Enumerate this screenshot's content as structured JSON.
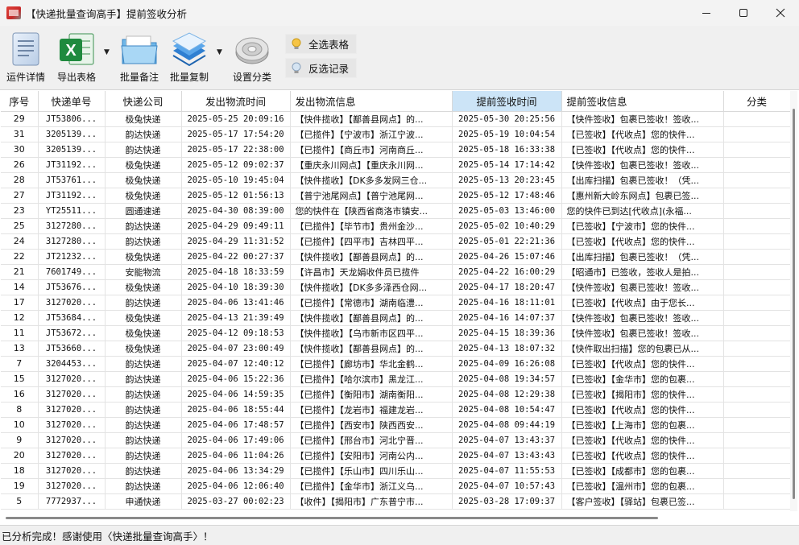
{
  "window": {
    "title": "【快递批量查询高手】提前签收分析",
    "controls": {
      "minimize": "—",
      "maximize": "☐",
      "close": "✕"
    }
  },
  "toolbar": {
    "buttons": [
      {
        "label": "运件详情",
        "icon": "document-icon"
      },
      {
        "label": "导出表格",
        "icon": "excel-icon",
        "dropdown": true
      },
      {
        "label": "批量备注",
        "icon": "folder-icon"
      },
      {
        "label": "批量复制",
        "icon": "copy-stack-icon",
        "dropdown": true
      },
      {
        "label": "设置分类",
        "icon": "gear-icon"
      }
    ],
    "select_all": "全选表格",
    "invert_select": "反选记录"
  },
  "table": {
    "columns": [
      "序号",
      "快递单号",
      "快递公司",
      "发出物流时间",
      "发出物流信息",
      "提前签收时间",
      "提前签收信息",
      "分类"
    ],
    "rows": [
      [
        "29",
        "JT53806...",
        "极兔快递",
        "2025-05-25 20:09:16",
        "【快件揽收】【鄯善县网点】的...",
        "2025-05-30 20:25:56",
        "【快件签收】包裹已签收！签收...",
        ""
      ],
      [
        "31",
        "3205139...",
        "韵达快递",
        "2025-05-17 17:54:20",
        "【已揽件】【宁波市】浙江宁波...",
        "2025-05-19 10:04:54",
        "【已签收】【代收点】您的快件...",
        ""
      ],
      [
        "30",
        "3205139...",
        "韵达快递",
        "2025-05-17 22:38:00",
        "【已揽件】【商丘市】河南商丘...",
        "2025-05-18 16:33:38",
        "【已签收】【代收点】您的快件...",
        ""
      ],
      [
        "26",
        "JT31192...",
        "极兔快递",
        "2025-05-12 09:02:37",
        "【重庆永川网点】【重庆永川网...",
        "2025-05-14 17:14:42",
        "【快件签收】包裹已签收！签收...",
        ""
      ],
      [
        "28",
        "JT53761...",
        "极兔快递",
        "2025-05-10 19:45:04",
        "【快件揽收】【DK多多发网三仓...",
        "2025-05-13 20:23:45",
        "【出库扫描】包裹已签收！（凭...",
        ""
      ],
      [
        "27",
        "JT31192...",
        "极兔快递",
        "2025-05-12 01:56:13",
        "【普宁池尾网点】【普宁池尾网...",
        "2025-05-12 17:48:46",
        "【惠州新大岭东网点】包裹已签...",
        ""
      ],
      [
        "23",
        "YT25511...",
        "圆通速递",
        "2025-04-30 08:39:00",
        "您的快件在【陕西省商洛市镇安...",
        "2025-05-03 13:46:00",
        "您的快件已到达[代收点](永福...",
        ""
      ],
      [
        "25",
        "3127280...",
        "韵达快递",
        "2025-04-29 09:49:11",
        "【已揽件】【毕节市】贵州金沙...",
        "2025-05-02 10:40:29",
        "【已签收】【宁波市】您的快件...",
        ""
      ],
      [
        "24",
        "3127280...",
        "韵达快递",
        "2025-04-29 11:31:52",
        "【已揽件】【四平市】吉林四平...",
        "2025-05-01 22:21:36",
        "【已签收】【代收点】您的快件...",
        ""
      ],
      [
        "22",
        "JT21232...",
        "极兔快递",
        "2025-04-22 00:27:37",
        "【快件揽收】【鄯善县网点】的...",
        "2025-04-26 15:07:46",
        "【出库扫描】包裹已签收！（凭...",
        ""
      ],
      [
        "21",
        "7601749...",
        "安能物流",
        "2025-04-18 18:33:59",
        "【许昌市】天龙娟收件员已揽件",
        "2025-04-22 16:00:29",
        "【昭通市】已签收，签收人是拍...",
        ""
      ],
      [
        "14",
        "JT53676...",
        "极兔快递",
        "2025-04-10 18:39:30",
        "【快件揽收】【DK多多泽西仓网...",
        "2025-04-17 18:20:47",
        "【快件签收】包裹已签收！签收...",
        ""
      ],
      [
        "17",
        "3127020...",
        "韵达快递",
        "2025-04-06 13:41:46",
        "【已揽件】【常德市】湖南临澧...",
        "2025-04-16 18:11:01",
        "【已签收】【代收点】由于您长...",
        ""
      ],
      [
        "12",
        "JT53684...",
        "极兔快递",
        "2025-04-13 21:39:49",
        "【快件揽收】【鄯善县网点】的...",
        "2025-04-16 14:07:37",
        "【快件签收】包裹已签收！签收...",
        ""
      ],
      [
        "11",
        "JT53672...",
        "极兔快递",
        "2025-04-12 09:18:53",
        "【快件揽收】【乌市新市区四平...",
        "2025-04-15 18:39:36",
        "【快件签收】包裹已签收！签收...",
        ""
      ],
      [
        "13",
        "JT53660...",
        "极兔快递",
        "2025-04-07 23:00:49",
        "【快件揽收】【鄯善县网点】的...",
        "2025-04-13 18:07:32",
        "【快件取出扫描】您的包裹已从...",
        ""
      ],
      [
        "7",
        "3204453...",
        "韵达快递",
        "2025-04-07 12:40:12",
        "【已揽件】【廊坊市】华北金鹤...",
        "2025-04-09 16:26:08",
        "【已签收】【代收点】您的快件...",
        ""
      ],
      [
        "15",
        "3127020...",
        "韵达快递",
        "2025-04-06 15:22:36",
        "【已揽件】【哈尔滨市】黑龙江...",
        "2025-04-08 19:34:57",
        "【已签收】【金华市】您的包裹...",
        ""
      ],
      [
        "16",
        "3127020...",
        "韵达快递",
        "2025-04-06 14:59:35",
        "【已揽件】【衡阳市】湖南衡阳...",
        "2025-04-08 12:29:38",
        "【已签收】【揭阳市】您的快件...",
        ""
      ],
      [
        "8",
        "3127020...",
        "韵达快递",
        "2025-04-06 18:55:44",
        "【已揽件】【龙岩市】福建龙岩...",
        "2025-04-08 10:54:47",
        "【已签收】【代收点】您的快件...",
        ""
      ],
      [
        "10",
        "3127020...",
        "韵达快递",
        "2025-04-06 17:48:57",
        "【已揽件】【西安市】陕西西安...",
        "2025-04-08 09:44:19",
        "【已签收】【上海市】您的包裹...",
        ""
      ],
      [
        "9",
        "3127020...",
        "韵达快递",
        "2025-04-06 17:49:06",
        "【已揽件】【邢台市】河北宁晋...",
        "2025-04-07 13:43:37",
        "【已签收】【代收点】您的快件...",
        ""
      ],
      [
        "20",
        "3127020...",
        "韵达快递",
        "2025-04-06 11:04:26",
        "【已揽件】【安阳市】河南公内...",
        "2025-04-07 13:43:43",
        "【已签收】【代收点】您的快件...",
        ""
      ],
      [
        "18",
        "3127020...",
        "韵达快递",
        "2025-04-06 13:34:29",
        "【已揽件】【乐山市】四川乐山...",
        "2025-04-07 11:55:53",
        "【已签收】【成都市】您的包裹...",
        ""
      ],
      [
        "19",
        "3127020...",
        "韵达快递",
        "2025-04-06 12:06:40",
        "【已揽件】【金华市】浙江义乌...",
        "2025-04-07 10:57:43",
        "【已签收】【温州市】您的包裹...",
        ""
      ],
      [
        "5",
        "7772937...",
        "申通快递",
        "2025-03-27 00:02:23",
        "【收件】【揭阳市】广东普宁市...",
        "2025-03-28 17:09:37",
        "【客户签收】【驿站】包裹已签...",
        ""
      ]
    ]
  },
  "status": {
    "text": "已分析完成！感谢使用〈快递批量查询高手〉！"
  }
}
